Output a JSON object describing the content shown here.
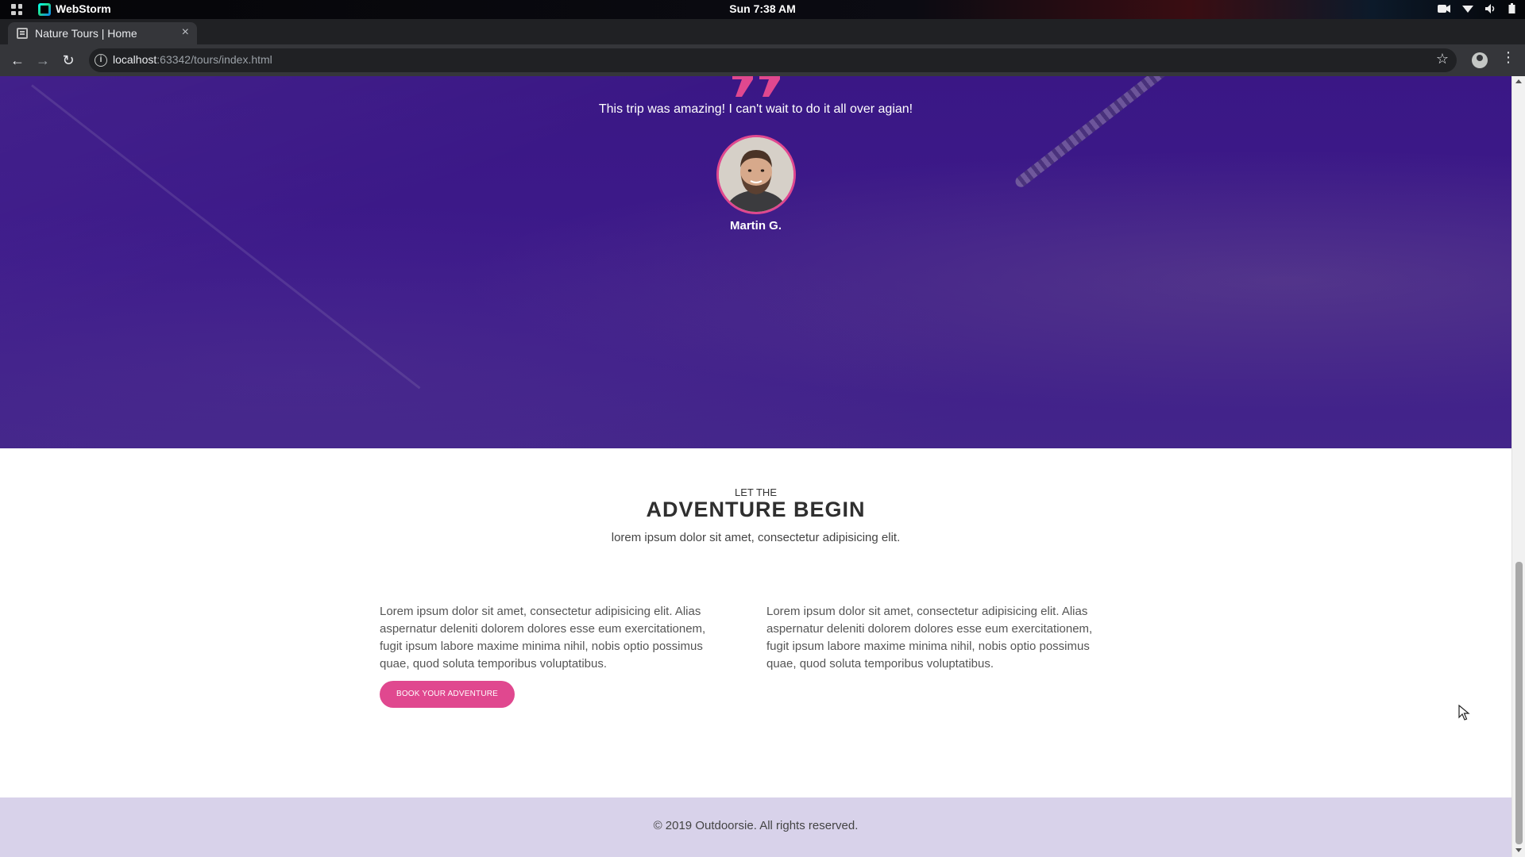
{
  "os": {
    "app_name": "WebStorm",
    "clock": "Sun  7:38 AM"
  },
  "browser": {
    "tab_title": "Nature Tours | Home",
    "tab_close": "×",
    "new_tab": "+",
    "url_host": "localhost",
    "url_rest": ":63342/tours/index.html",
    "info_glyph": "i",
    "star_glyph": "☆",
    "back_glyph": "←",
    "forward_glyph": "→",
    "reload_glyph": "↻",
    "menu_glyph": "⋮",
    "window_controls": {
      "minimize_color": "#f29a2e",
      "maximize_color": "#3f8ae0",
      "close_color": "#e8322e"
    }
  },
  "testimonial": {
    "quote": "This trip was amazing! I can't wait to do it all over agian!",
    "author": "Martin G.",
    "accent_color": "#e0488f"
  },
  "adventure": {
    "kicker": "LET THE",
    "heading": "ADVENTURE BEGIN",
    "subheading": "lorem ipsum dolor sit amet, consectetur adipisicing elit.",
    "columns": [
      "Lorem ipsum dolor sit amet, consectetur adipisicing elit. Alias aspernatur deleniti dolorem dolores esse eum exercitationem, fugit ipsum labore maxime minima nihil, nobis optio possimus quae, quod soluta temporibus voluptatibus.",
      "Lorem ipsum dolor sit amet, consectetur adipisicing elit. Alias aspernatur deleniti dolorem dolores esse eum exercitationem, fugit ipsum labore maxime minima nihil, nobis optio possimus quae, quod soluta temporibus voluptatibus."
    ],
    "cta_label": "BOOK YOUR ADVENTURE"
  },
  "footer": {
    "copyright": "© 2019 Outdoorsie. All rights reserved."
  }
}
